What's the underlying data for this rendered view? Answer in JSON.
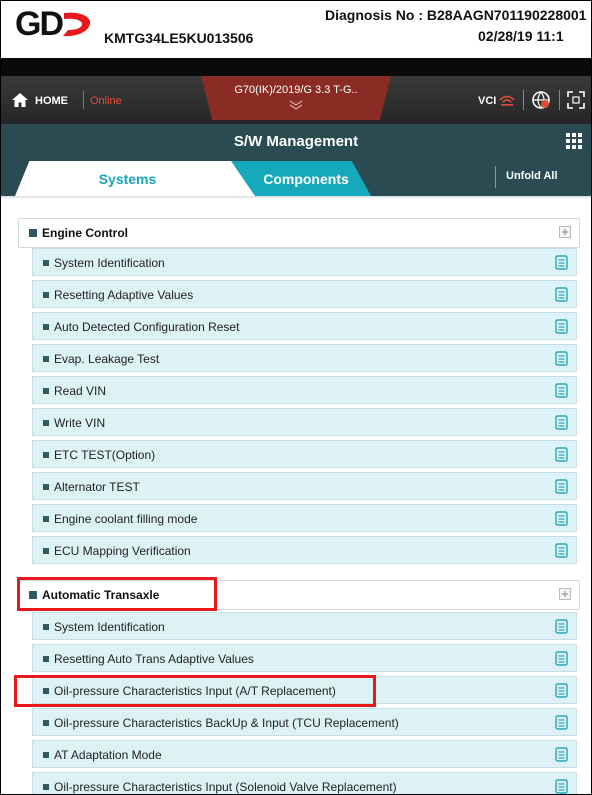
{
  "header": {
    "logo_text": "GD",
    "vin": "KMTG34LE5KU013506",
    "diagnosis": "Diagnosis No : B28AAGN701190228001",
    "datetime": "02/28/19 11:1"
  },
  "nav": {
    "home_label": "HOME",
    "status": "Online",
    "vehicle": "G70(IK)/2019/G 3.3 T-G..",
    "vci_label": "VCI"
  },
  "title": "S/W Management",
  "tabs": {
    "systems": "Systems",
    "components": "Components",
    "unfold": "Unfold All"
  },
  "groups": [
    {
      "label": "Engine Control",
      "items": [
        {
          "label": "System Identification"
        },
        {
          "label": "Resetting Adaptive Values"
        },
        {
          "label": "Auto Detected Configuration Reset"
        },
        {
          "label": "Evap. Leakage Test"
        },
        {
          "label": "Read VIN"
        },
        {
          "label": "Write VIN"
        },
        {
          "label": "ETC TEST(Option)"
        },
        {
          "label": "Alternator TEST"
        },
        {
          "label": "Engine coolant filling mode"
        },
        {
          "label": "ECU Mapping Verification"
        }
      ]
    },
    {
      "label": "Automatic Transaxle",
      "items": [
        {
          "label": "System Identification"
        },
        {
          "label": "Resetting Auto Trans Adaptive Values"
        },
        {
          "label": "Oil-pressure Characteristics Input (A/T Replacement)"
        },
        {
          "label": "Oil-pressure Characteristics BackUp & Input (TCU Replacement)"
        },
        {
          "label": "AT Adaptation Mode"
        },
        {
          "label": "Oil-pressure Characteristics Input (Solenoid Valve Replacement)"
        }
      ]
    }
  ],
  "colors": {
    "accent": "#16a9bc",
    "title_bar": "#2b4b53",
    "item_bg": "#ddf2f6",
    "highlight": "#e8191c",
    "vehicle_tab": "#8a2c24"
  }
}
